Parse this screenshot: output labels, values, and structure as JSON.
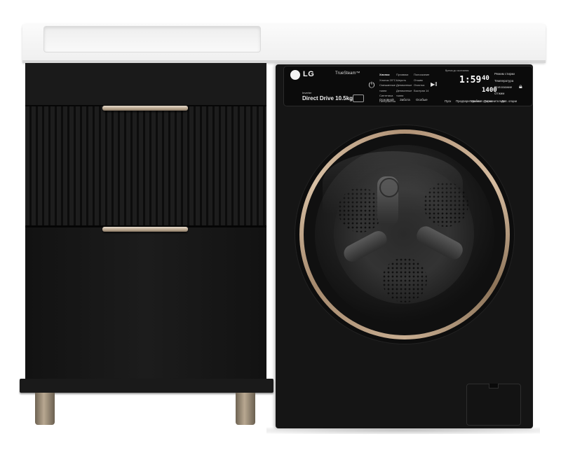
{
  "image": {
    "subject": "washer-and-cabinet",
    "colors": {
      "body": "#151515",
      "countertop": "#f4f4f4",
      "handles": "#b7a48d",
      "door_ring": "#c8ae92"
    }
  },
  "washer": {
    "brand": "LG",
    "steam": "TrueSteam™",
    "inverter": "Inverter",
    "drive": "Direct Drive 10.5kg",
    "programs_col1": [
      "Хлопок",
      "Хлопок 20°C",
      "Смешанные ткани",
      "Синтетика",
      "Гиперчистка"
    ],
    "programs_col2": [
      "Пуховики",
      "Шерсть",
      "Деликатные",
      "Деликатные ткани"
    ],
    "programs_col3": [
      "Полоскание",
      "Отжим",
      "Очистка",
      "Быстрая 14"
    ],
    "program_bottom": [
      "Основной",
      "Забота",
      "Особые"
    ],
    "display_header": "Время до окончания",
    "display_time": "1:59",
    "display_temp": "40",
    "display_spin": "1400",
    "options_right": [
      "Режим стирки",
      "Температура",
      "Полоскание",
      "Отжим"
    ],
    "options_bottom": [
      "Пуск",
      "Предварительная",
      "Удобная стирка",
      "Дополнительно",
      "Доп. опции"
    ]
  }
}
